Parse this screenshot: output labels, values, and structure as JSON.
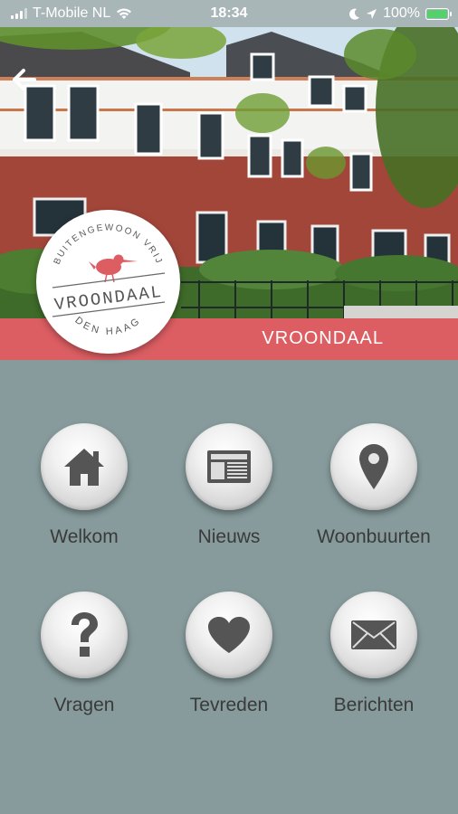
{
  "status_bar": {
    "carrier": "T-Mobile NL",
    "time": "18:34",
    "battery": "100%"
  },
  "header": {
    "title": "VROONDAAL"
  },
  "logo": {
    "top_text": "BUITENGEWOON VRIJ",
    "name": "VROONDAAL",
    "bottom_text": "DEN HAAG",
    "accent": "#dc5e63"
  },
  "menu": [
    {
      "label": "Welkom",
      "icon": "home-icon"
    },
    {
      "label": "Nieuws",
      "icon": "newspaper-icon"
    },
    {
      "label": "Woonbuurten",
      "icon": "map-pin-icon"
    },
    {
      "label": "Vragen",
      "icon": "question-icon"
    },
    {
      "label": "Tevreden",
      "icon": "heart-icon"
    },
    {
      "label": "Berichten",
      "icon": "envelope-icon"
    }
  ],
  "colors": {
    "background": "#879b9c",
    "band": "#dc5e63",
    "icon": "#555555",
    "label": "#3a3a3a"
  }
}
